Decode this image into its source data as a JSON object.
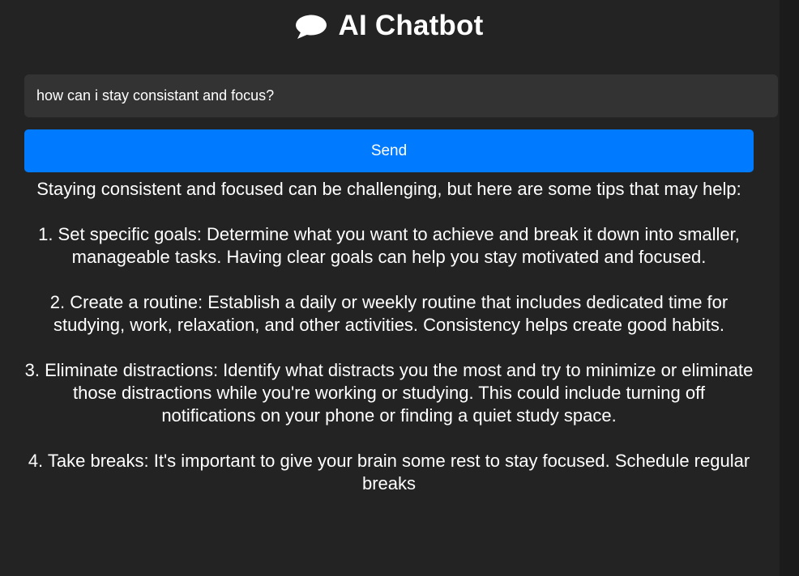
{
  "app": {
    "title": "AI Chatbot",
    "icon": "speech-bubble-icon"
  },
  "input": {
    "value": "how can i stay consistant and focus?"
  },
  "send_button": {
    "label": "Send",
    "color": "#007bff"
  },
  "response": {
    "paragraphs": [
      "Staying consistent and focused can be challenging, but here are some tips that may help:",
      "1. Set specific goals: Determine what you want to achieve and break it down into smaller, manageable tasks. Having clear goals can help you stay motivated and focused.",
      "2. Create a routine: Establish a daily or weekly routine that includes dedicated time for studying, work, relaxation, and other activities. Consistency helps create good habits.",
      "3. Eliminate distractions: Identify what distracts you the most and try to minimize or eliminate those distractions while you're working or studying. This could include turning off notifications on your phone or finding a quiet study space.",
      "4. Take breaks: It's important to give your brain some rest to stay focused. Schedule regular breaks"
    ]
  },
  "colors": {
    "background": "#232323",
    "input_background": "#333333",
    "text": "#ffffff"
  }
}
